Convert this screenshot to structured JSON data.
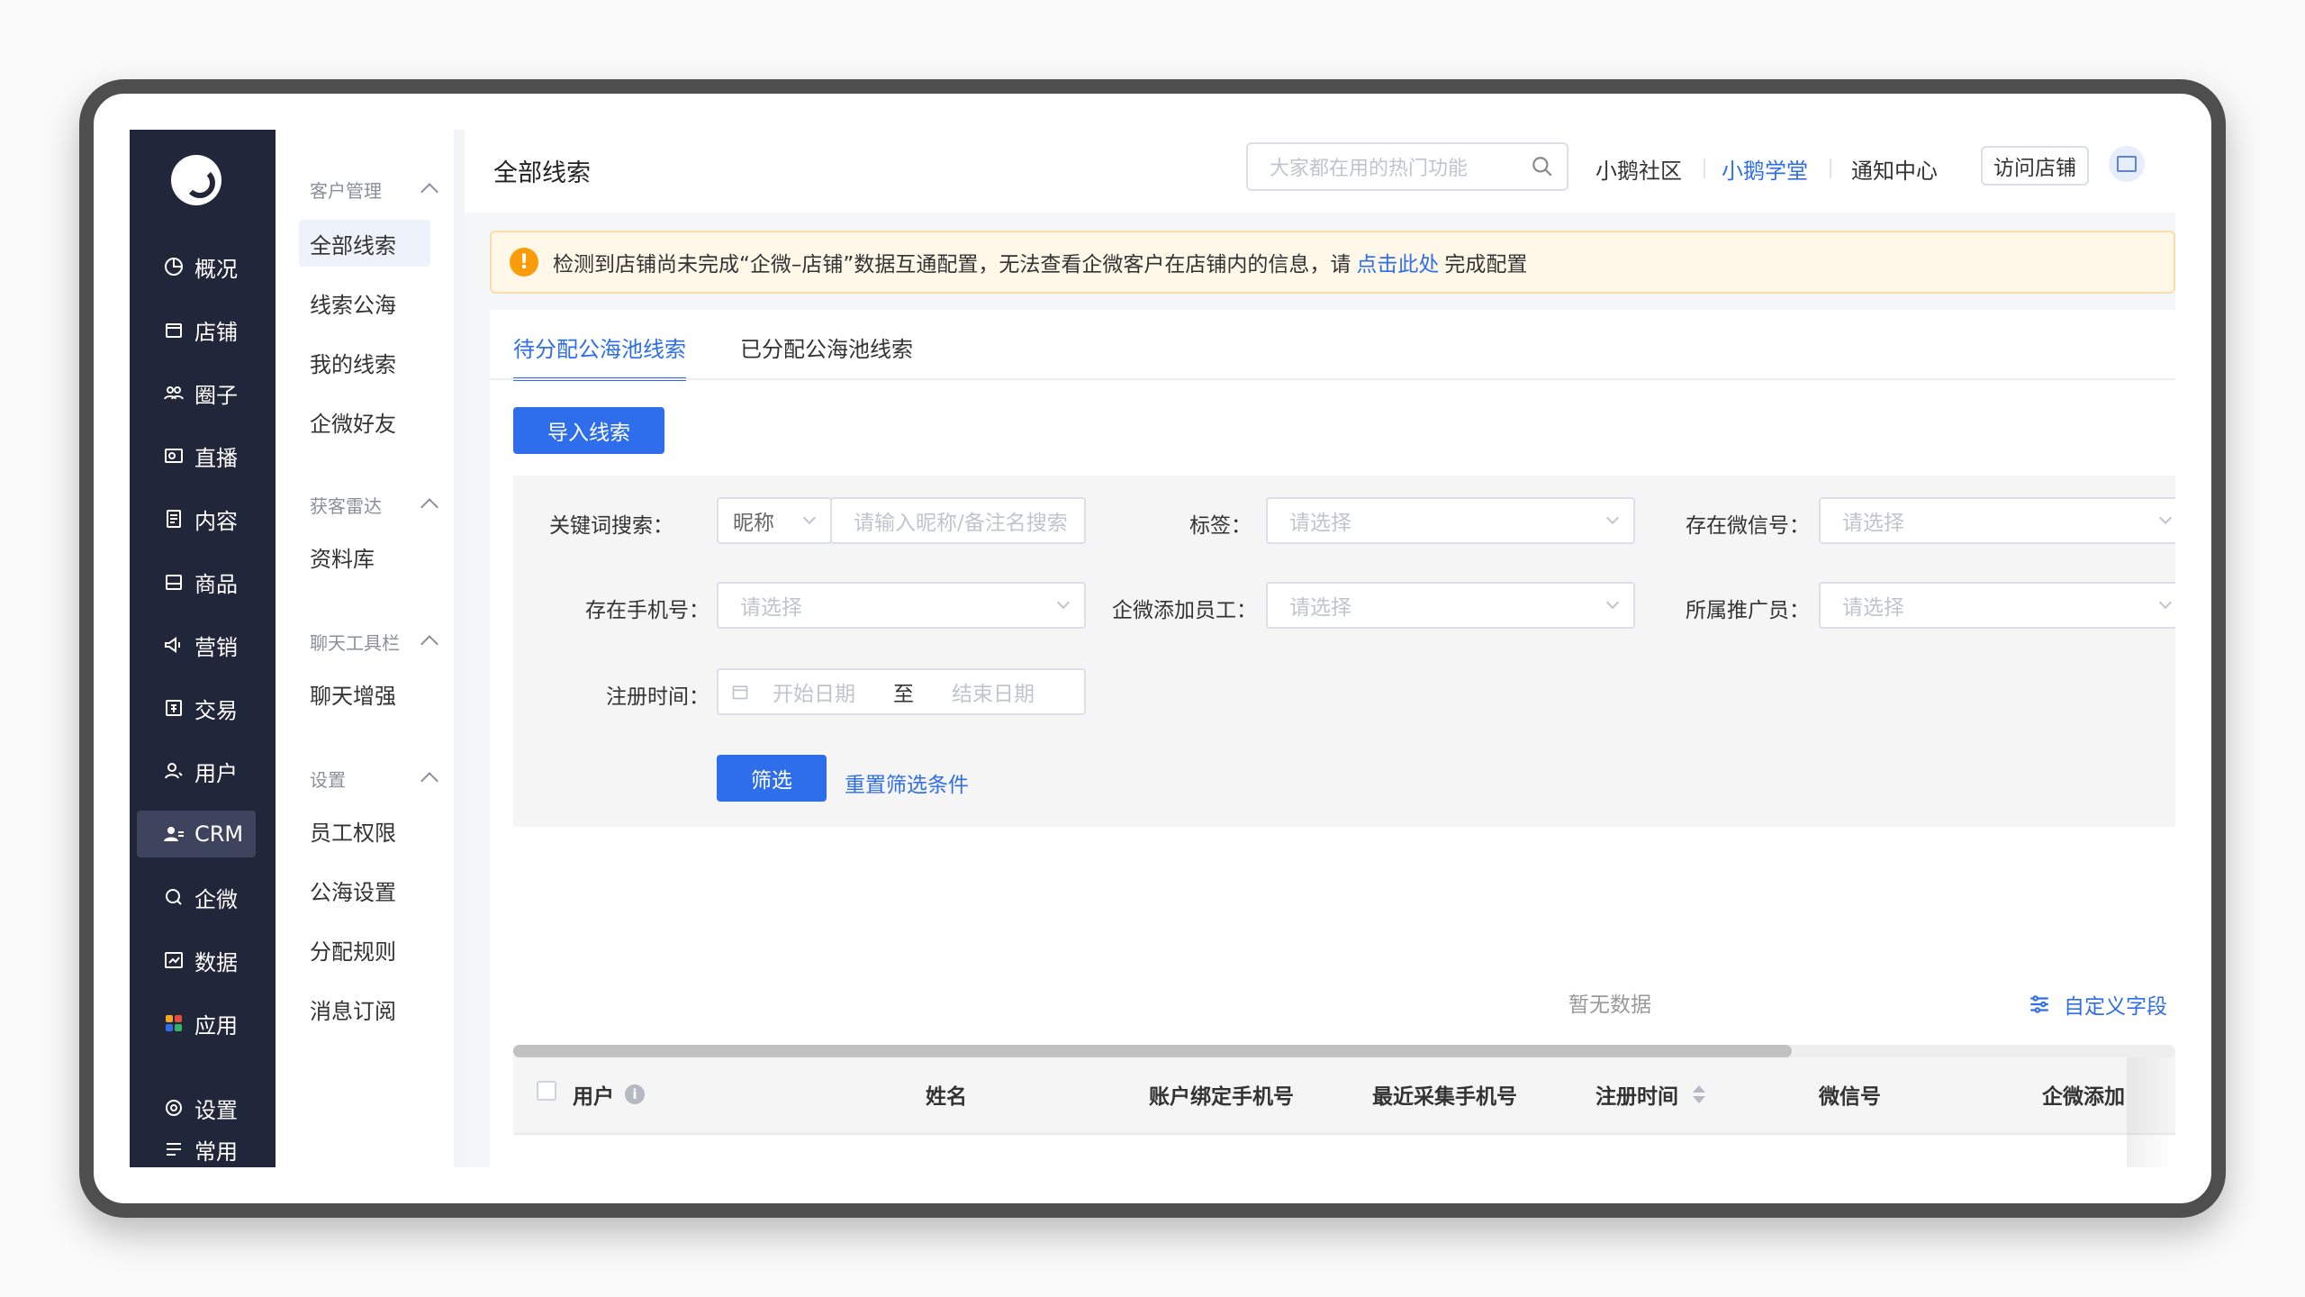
{
  "nav": {
    "items": [
      {
        "label": "概况",
        "icon": "dashboard-icon"
      },
      {
        "label": "店铺",
        "icon": "store-icon"
      },
      {
        "label": "圈子",
        "icon": "community-icon"
      },
      {
        "label": "直播",
        "icon": "live-icon"
      },
      {
        "label": "内容",
        "icon": "content-icon"
      },
      {
        "label": "商品",
        "icon": "goods-icon"
      },
      {
        "label": "营销",
        "icon": "marketing-icon"
      },
      {
        "label": "交易",
        "icon": "trade-icon"
      },
      {
        "label": "用户",
        "icon": "user-icon"
      },
      {
        "label": "CRM",
        "icon": "crm-icon"
      },
      {
        "label": "企微",
        "icon": "wecom-icon"
      },
      {
        "label": "数据",
        "icon": "data-icon"
      },
      {
        "label": "应用",
        "icon": "apps-icon"
      },
      {
        "label": "设置",
        "icon": "settings-icon"
      },
      {
        "label": "常用",
        "icon": "frequent-icon"
      }
    ]
  },
  "subnav": {
    "groups": [
      {
        "title": "客户管理",
        "items": [
          "全部线索",
          "线索公海",
          "我的线索",
          "企微好友"
        ]
      },
      {
        "title": "获客雷达",
        "items": [
          "资料库"
        ]
      },
      {
        "title": "聊天工具栏",
        "items": [
          "聊天增强"
        ]
      },
      {
        "title": "设置",
        "items": [
          "员工权限",
          "公海设置",
          "分配规则",
          "消息订阅"
        ]
      }
    ]
  },
  "header": {
    "title": "全部线索",
    "search_placeholder": "大家都在用的热门功能",
    "links": [
      "小鹅社区",
      "小鹅学堂",
      "通知中心"
    ],
    "visit_store": "访问店铺"
  },
  "alert": {
    "text_before": "检测到店铺尚未完成“企微–店铺”数据互通配置，无法查看企微客户在店铺内的信息，请",
    "link": "点击此处",
    "text_after": "完成配置"
  },
  "tabs": [
    "待分配公海池线索",
    "已分配公海池线索"
  ],
  "import_button": "导入线索",
  "filters": {
    "keyword_label": "关键词搜索：",
    "keyword_type": "昵称",
    "keyword_placeholder": "请输入昵称/备注名搜索",
    "tag_label": "标签：",
    "wechat_label": "存在微信号：",
    "phone_label": "存在手机号：",
    "staff_label": "企微添加员工：",
    "promoter_label": "所属推广员：",
    "select_placeholder": "请选择",
    "register_label": "注册时间：",
    "start_placeholder": "开始日期",
    "range_sep": "至",
    "end_placeholder": "结束日期",
    "filter_button": "筛选",
    "reset_link": "重置筛选条件"
  },
  "custom_field": "自定义字段",
  "table": {
    "columns": [
      "用户",
      "姓名",
      "账户绑定手机号",
      "最近采集手机号",
      "注册时间",
      "微信号",
      "企微添加"
    ],
    "empty_text": "暂无数据"
  }
}
